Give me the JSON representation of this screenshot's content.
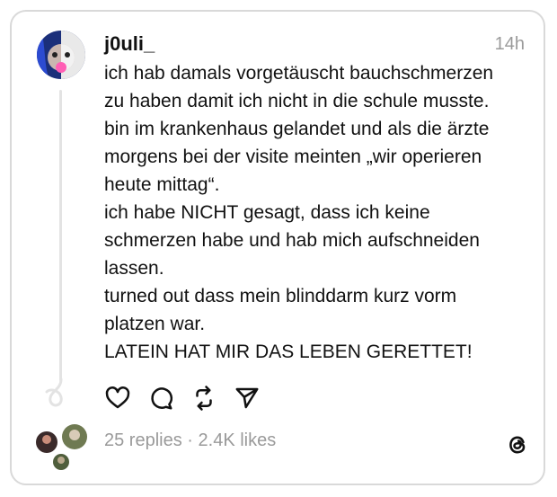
{
  "post": {
    "username": "j0uli_",
    "time": "14h",
    "lines": [
      "ich hab damals vorgetäuscht bauchschmerzen",
      "zu haben damit ich nicht in die schule musste.",
      "bin im krankenhaus gelandet und als die ärzte",
      "morgens bei der visite meinten „wir operieren",
      "heute mittag“.",
      "ich habe NICHT gesagt, dass ich keine",
      "schmerzen habe und hab mich aufschneiden",
      "lassen.",
      "turned out dass mein blinddarm kurz vorm",
      "platzen war.",
      "LATEIN HAT MIR DAS LEBEN GERETTET!"
    ],
    "replies_text": "25 replies",
    "separator": "·",
    "likes_text": "2.4K likes"
  },
  "icons": {
    "like": "heart-icon",
    "reply": "comment-icon",
    "repost": "repost-icon",
    "share": "send-icon",
    "brand": "threads-logo-icon"
  },
  "colors": {
    "text": "#111111",
    "muted": "#9a9a9a",
    "border": "#d9d9d9",
    "line": "#e3e3e3"
  }
}
